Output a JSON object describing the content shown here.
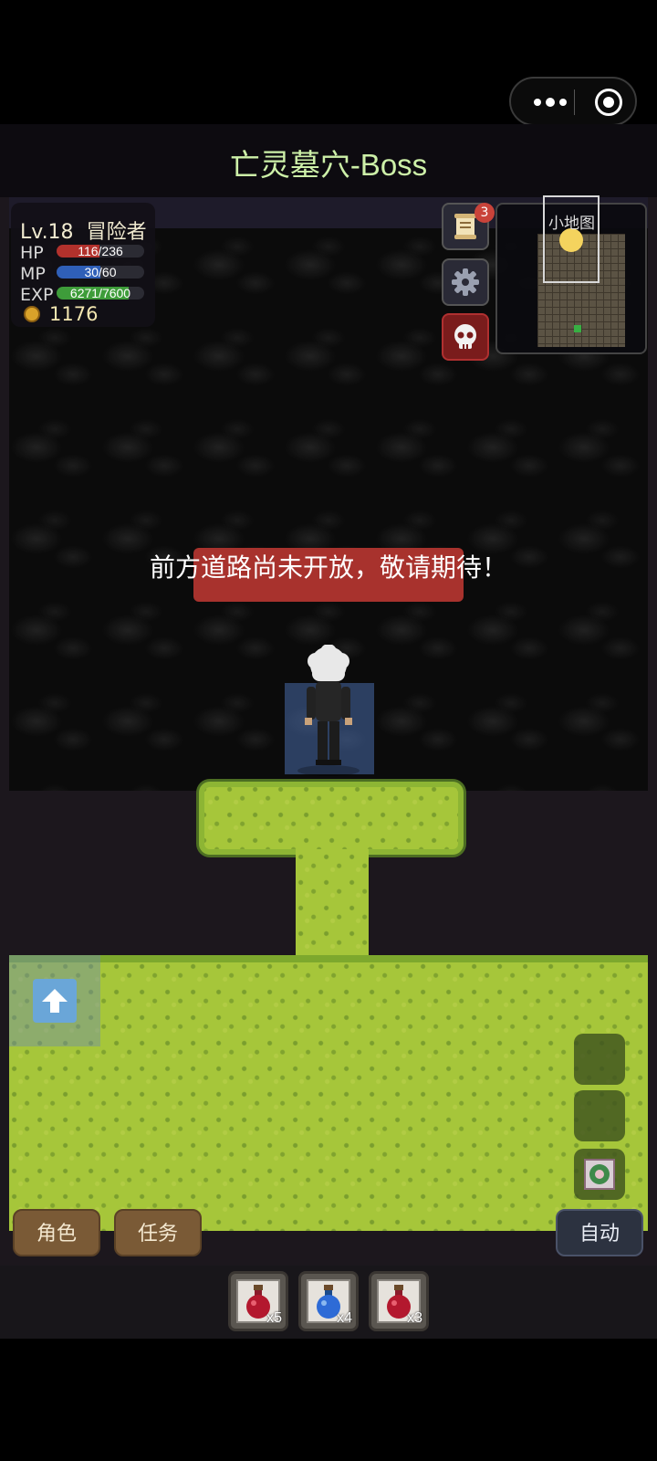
{
  "window": {
    "title": "亡灵墓穴-Boss"
  },
  "capsule": {
    "more_icon": "more-dots-icon",
    "close_icon": "target-circle-icon"
  },
  "hud": {
    "level": "Lv.18",
    "class": "冒险者",
    "hp_label": "HP",
    "hp": "116/236",
    "hp_value": 116,
    "hp_max": 236,
    "mp_label": "MP",
    "mp": "30/60",
    "mp_value": 30,
    "mp_max": 60,
    "exp_label": "EXP",
    "exp": "6271/7600",
    "exp_value": 6271,
    "exp_max": 7600,
    "gold": "1176",
    "colors": {
      "hp": "#b2312c",
      "mp": "#2f5fb8",
      "exp": "#3e9c3a"
    }
  },
  "side_buttons": {
    "quest_scroll_icon": "scroll-icon",
    "quest_badge": "3",
    "settings_icon": "gear-icon",
    "boss_icon": "skull-icon"
  },
  "minimap": {
    "label": "小地图"
  },
  "notice": {
    "text": "前方道路尚未开放，敬请期待！"
  },
  "controls": {
    "jump_icon": "up-arrow-icon",
    "role_label": "角色",
    "task_label": "任务",
    "auto_label": "自动"
  },
  "potions": [
    {
      "icon": "red-potion-icon",
      "count": "x5",
      "color": "#b3182e"
    },
    {
      "icon": "blue-potion-icon",
      "count": "x4",
      "color": "#2e6bd6"
    },
    {
      "icon": "red-potion-icon",
      "count": "x3",
      "color": "#b3182e"
    }
  ]
}
